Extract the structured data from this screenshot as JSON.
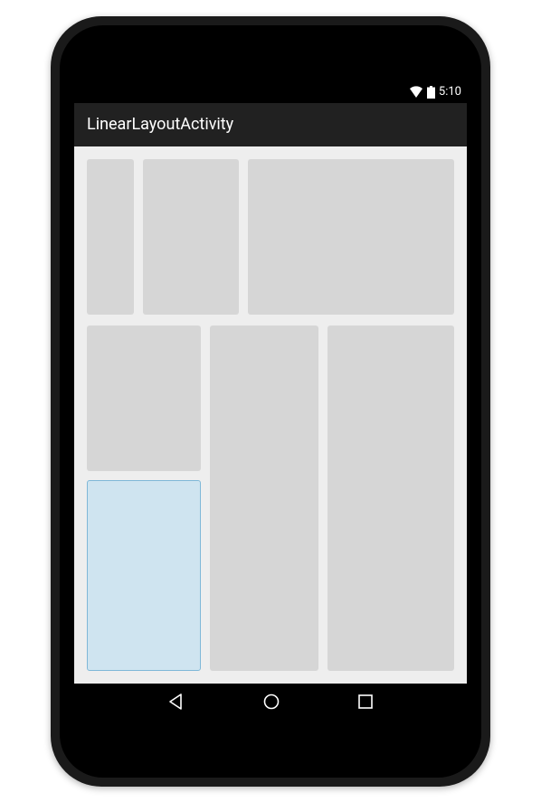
{
  "status": {
    "time": "5:10"
  },
  "appbar": {
    "title": "LinearLayoutActivity"
  }
}
